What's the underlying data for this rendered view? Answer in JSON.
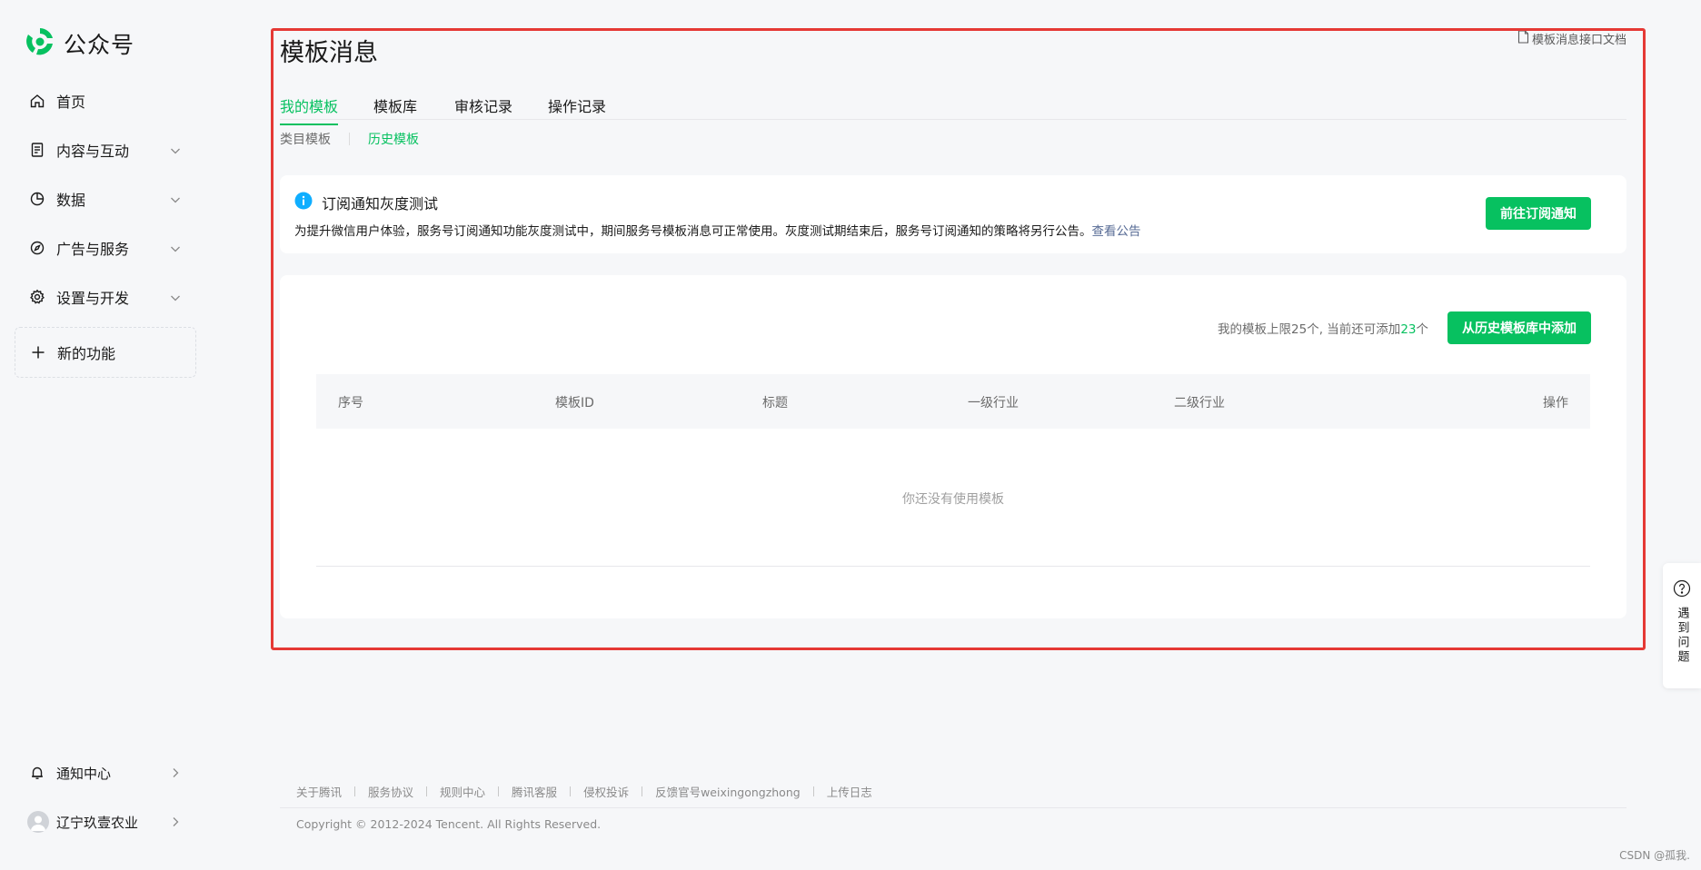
{
  "sidebar": {
    "logo_text": "公众号",
    "items": [
      {
        "label": "首页"
      },
      {
        "label": "内容与互动"
      },
      {
        "label": "数据"
      },
      {
        "label": "广告与服务"
      },
      {
        "label": "设置与开发"
      }
    ],
    "new_feature_label": "新的功能",
    "notification_label": "通知中心",
    "account_name": "辽宁玖壹农业"
  },
  "page": {
    "title": "模板消息",
    "doc_link": "模板消息接口文档"
  },
  "tabs": [
    {
      "label": "我的模板",
      "active": true
    },
    {
      "label": "模板库",
      "active": false
    },
    {
      "label": "审核记录",
      "active": false
    },
    {
      "label": "操作记录",
      "active": false
    }
  ],
  "subtabs": [
    {
      "label": "类目模板",
      "active": false
    },
    {
      "label": "历史模板",
      "active": true
    }
  ],
  "notice": {
    "title": "订阅通知灰度测试",
    "description": "为提升微信用户体验，服务号订阅通知功能灰度测试中，期间服务号模板消息可正常使用。灰度测试期结束后，服务号订阅通知的策略将另行公告。",
    "link": "查看公告",
    "button": "前往订阅通知"
  },
  "template_list": {
    "limit_prefix": "我的模板上限25个, 当前还可添加",
    "limit_remaining": "23",
    "limit_suffix": "个",
    "add_button": "从历史模板库中添加",
    "columns": [
      "序号",
      "模板ID",
      "标题",
      "一级行业",
      "二级行业",
      "操作"
    ],
    "rows": [],
    "empty_text": "你还没有使用模板"
  },
  "footer": {
    "links": [
      "关于腾讯",
      "服务协议",
      "规则中心",
      "腾讯客服",
      "侵权投诉",
      "反馈官号weixingongzhong",
      "上传日志"
    ],
    "copyright": "Copyright © 2012-2024 Tencent. All Rights Reserved."
  },
  "help_float": {
    "label": "遇到问题"
  },
  "watermark": "CSDN @孤我.",
  "colors": {
    "accent": "#07c160",
    "link": "#576b95",
    "highlight_border": "#e53935",
    "info_icon": "#10aeff"
  }
}
